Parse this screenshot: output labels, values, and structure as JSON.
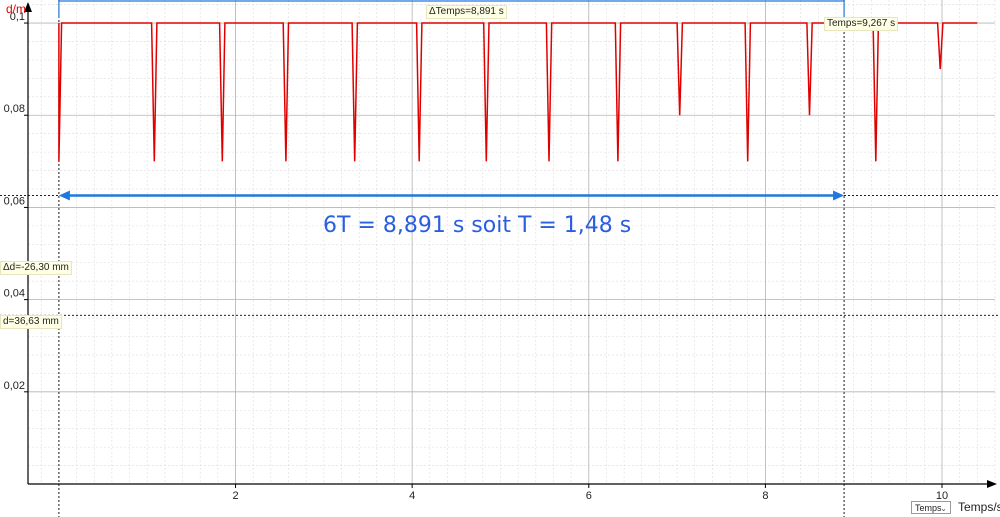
{
  "chart_data": {
    "type": "line",
    "ylabel": "d/m",
    "xlabel": "Temps/s",
    "xlim": [
      -0.35,
      10.6
    ],
    "ylim": [
      0.0,
      0.105
    ],
    "xticks": [
      "2",
      "4",
      "6",
      "8",
      "10"
    ],
    "yticks": [
      "0,1",
      "0,08",
      "0,06",
      "0,04",
      "0,02"
    ],
    "grid": true,
    "series_color": "#e00000",
    "baseline": 0.1,
    "dips": [
      {
        "x": 0.0,
        "y": 0.07
      },
      {
        "x": 1.08,
        "y": 0.07
      },
      {
        "x": 1.85,
        "y": 0.07
      },
      {
        "x": 2.57,
        "y": 0.07
      },
      {
        "x": 3.35,
        "y": 0.07
      },
      {
        "x": 4.08,
        "y": 0.07
      },
      {
        "x": 4.84,
        "y": 0.07
      },
      {
        "x": 5.55,
        "y": 0.07
      },
      {
        "x": 6.33,
        "y": 0.07
      },
      {
        "x": 7.03,
        "y": 0.08
      },
      {
        "x": 7.8,
        "y": 0.07
      },
      {
        "x": 8.5,
        "y": 0.08
      },
      {
        "x": 9.25,
        "y": 0.07
      },
      {
        "x": 9.98,
        "y": 0.09
      }
    ],
    "x_range": [
      0.0,
      10.4
    ],
    "cursors": {
      "t1": 0.0,
      "t2": 8.891,
      "y1": 0.0626,
      "y2": 0.0366
    },
    "cursor_labels": {
      "delta_time": "ΔTemps=8,891 s",
      "time": "Temps=9,267 s",
      "delta_d": "Δd=-26,30 mm",
      "d": "d=36,63 mm"
    },
    "annotation": "6T = 8,891 s    soit  T = 1,48 s",
    "accent_color": "#1e78e0",
    "annotation_color": "#2a5ee0"
  },
  "axis_selector": {
    "value": "Temps"
  }
}
